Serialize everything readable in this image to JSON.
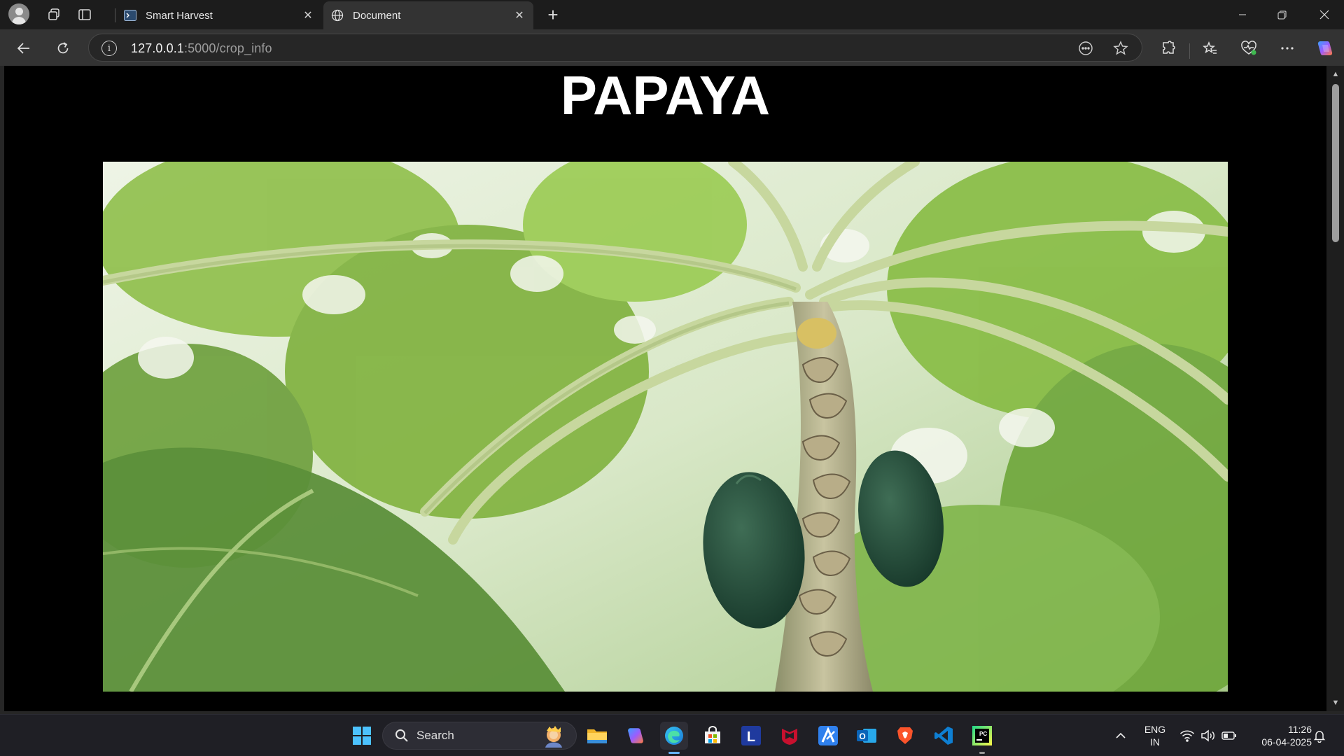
{
  "browser": {
    "tabs": [
      {
        "title": "Smart Harvest",
        "active": false,
        "close_glyph": "✕"
      },
      {
        "title": "Document",
        "active": true,
        "close_glyph": "✕"
      }
    ],
    "new_tab_glyph": "+",
    "address": {
      "host": "127.0.0.1",
      "path": ":5000/crop_info"
    }
  },
  "page": {
    "heading": "PAPAYA",
    "image_alt": "papaya tree"
  },
  "taskbar": {
    "search_label": "Search",
    "language_line1": "ENG",
    "language_line2": "IN",
    "time": "11:26",
    "date": "06-04-2025"
  },
  "colors": {
    "page_bg": "#000000",
    "heading": "#ffffff",
    "browser_chrome": "#333333",
    "taskbar": "#1f1f25",
    "accent": "#66b3ff"
  }
}
